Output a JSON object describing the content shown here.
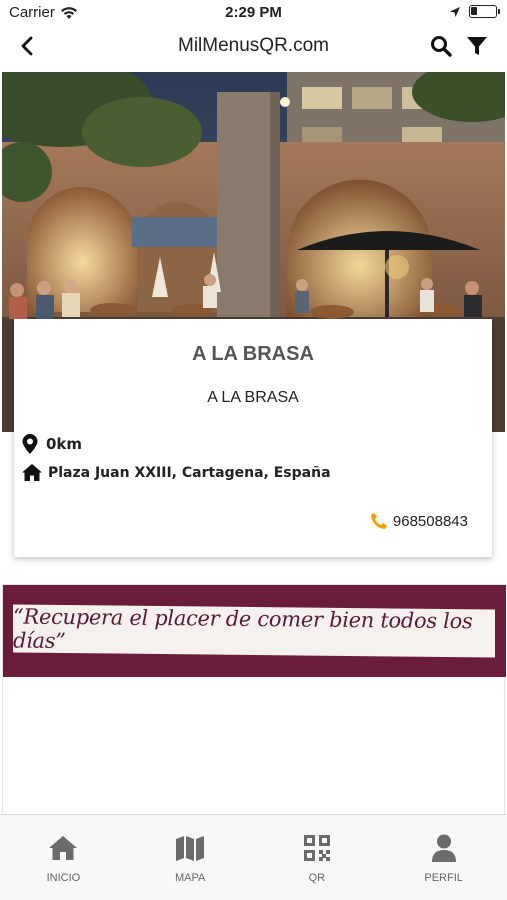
{
  "status_bar": {
    "carrier": "Carrier",
    "time": "2:29 PM"
  },
  "nav": {
    "title": "MilMenusQR.com"
  },
  "restaurant": {
    "name": "A LA BRASA",
    "subtitle": "A LA BRASA",
    "distance": "0km",
    "address": "Plaza Juan XXIII, Cartagena, España",
    "phone": "968508843"
  },
  "banner": {
    "quote": "“Recupera el placer de comer bien todos los días”"
  },
  "tabs": [
    {
      "label": "INICIO",
      "icon": "home-icon"
    },
    {
      "label": "MAPA",
      "icon": "map-icon"
    },
    {
      "label": "QR",
      "icon": "qr-icon"
    },
    {
      "label": "PERFIL",
      "icon": "user-icon"
    }
  ],
  "colors": {
    "accent_phone": "#f5a300",
    "banner_bg": "#6a1d3a",
    "tab_icon": "#6b6b6b"
  }
}
